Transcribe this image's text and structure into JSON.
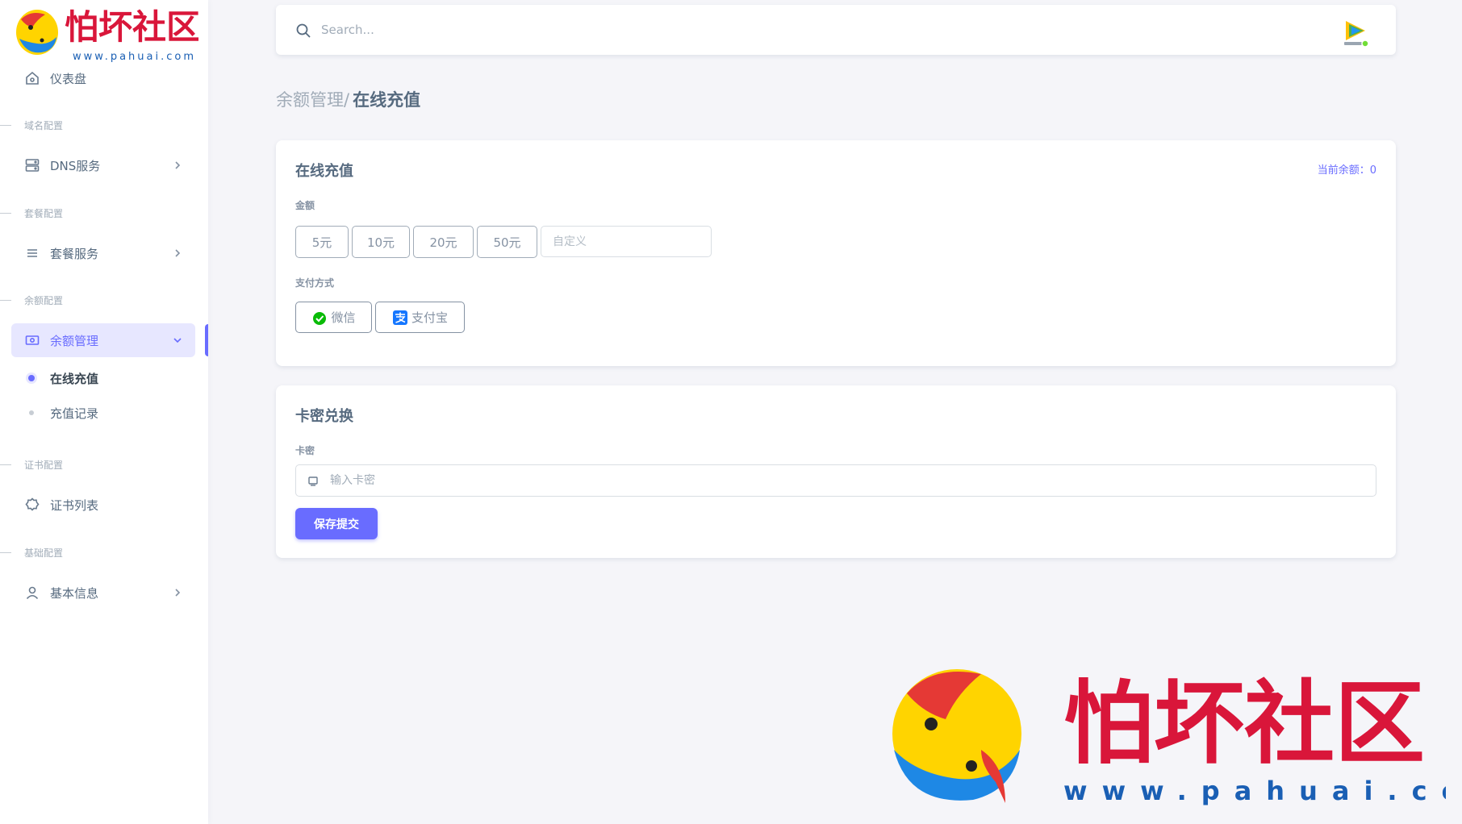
{
  "brand": {
    "name": "怕坏社区",
    "url": "www.pahuai.com"
  },
  "sidebar": {
    "dashboard": "仪表盘",
    "sections": {
      "domain": "域名配置",
      "package": "套餐配置",
      "balance": "余额配置",
      "cert": "证书配置",
      "basic": "基础配置"
    },
    "items": {
      "dns": "DNS服务",
      "package": "套餐服务",
      "balance": "余额管理",
      "online_recharge": "在线充值",
      "recharge_records": "充值记录",
      "cert_list": "证书列表",
      "basic_info": "基本信息"
    }
  },
  "search": {
    "placeholder": "Search..."
  },
  "breadcrumb": {
    "parent": "余额管理/",
    "current": "在线充值"
  },
  "recharge_card": {
    "title": "在线充值",
    "balance_label": "当前余额：",
    "balance_value": "0",
    "amount_label": "金额",
    "amounts": [
      "5元",
      "10元",
      "20元",
      "50元"
    ],
    "custom_placeholder": "自定义",
    "payment_label": "支付方式",
    "payments": {
      "wechat": "微信",
      "alipay": "支付宝"
    }
  },
  "redeem_card": {
    "title": "卡密兑换",
    "field_label": "卡密",
    "placeholder": "输入卡密",
    "submit": "保存提交"
  },
  "colors": {
    "primary": "#696cff",
    "primary_light": "#e7e7ff",
    "wechat": "#09bb07",
    "alipay": "#1677ff",
    "watermark_red": "#d9163a",
    "watermark_blue": "#1a5fb4"
  }
}
